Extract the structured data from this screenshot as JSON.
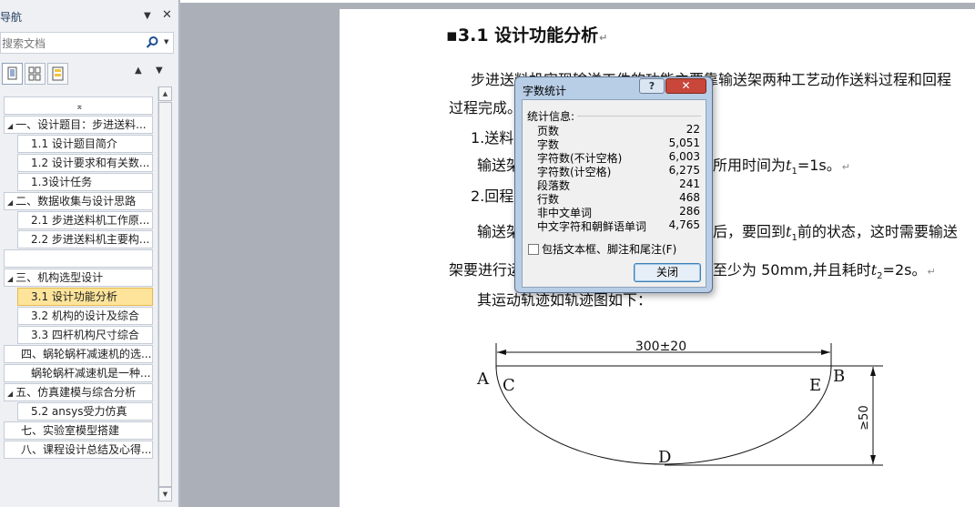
{
  "nav": {
    "title": "导航",
    "dropdown_icon": "triangle-down-icon",
    "close_glyph": "✕",
    "search_placeholder": "搜索文档",
    "search_icon": "search-icon",
    "view_buttons": [
      "headings-view-icon",
      "pages-view-icon",
      "results-view-icon"
    ],
    "prev_glyph": "▲",
    "next_glyph": "▼",
    "collapse_glyph": "⌅",
    "items": [
      {
        "label": "",
        "level": 1,
        "type": "collapse"
      },
      {
        "label": "一、设计题目：步进送料...",
        "level": 1,
        "expanded": true
      },
      {
        "label": "1.1 设计题目简介",
        "level": 2
      },
      {
        "label": "1.2 设计要求和有关数...",
        "level": 2
      },
      {
        "label": "1.3设计任务",
        "level": 2
      },
      {
        "label": "二、数据收集与设计思路",
        "level": 1,
        "expanded": true
      },
      {
        "label": "2.1 步进送料机工作原...",
        "level": 2
      },
      {
        "label": "2.2 步进送料机主要构...",
        "level": 2
      },
      {
        "label": "",
        "level": 1
      },
      {
        "label": "三、机构选型设计",
        "level": 1,
        "expanded": true
      },
      {
        "label": "3.1 设计功能分析",
        "level": 2,
        "selected": true
      },
      {
        "label": "3.2 机构的设计及综合",
        "level": 2
      },
      {
        "label": "3.3 四杆机构尺寸综合",
        "level": 2
      },
      {
        "label": "四、蜗轮蜗杆减速机的选...",
        "level": 1
      },
      {
        "label": "蜗轮蜗杆减速机是一种...",
        "level": 2
      },
      {
        "label": "五、仿真建模与综合分析",
        "level": 1,
        "expanded": true
      },
      {
        "label": "5.2 ansys受力仿真",
        "level": 2
      },
      {
        "label": "七、实验室模型搭建",
        "level": 1
      },
      {
        "label": "八、课程设计总结及心得...",
        "level": 1
      }
    ]
  },
  "document": {
    "heading": "3.1  设计功能分析",
    "para1_a": "步进送料机实现输送工件的功能主要靠输送架两种工艺动作送料过程和回程",
    "para1_b": "过程完成。",
    "item1": "1.送料过",
    "item1_body_a": "输送架",
    "item1_body_b": "所用时间为",
    "item1_var": "t",
    "item1_sub": "1",
    "item1_tail": "=1s。",
    "item2": "2.回程过",
    "item2_body_a": "输送架",
    "item2_body_b": "后，要回到",
    "item2_var": "t",
    "item2_sub": "1",
    "item2_tail": "前的状态，这时需要输送",
    "item2_line2_a": "架要进行运",
    "item2_line2_b": "至少为 50mm,并且耗时",
    "item2_var2": "t",
    "item2_sub2": "2",
    "item2_tail2": "=2s。",
    "para3": "其运动轨迹如轨迹图如下：",
    "pm": "↵"
  },
  "figure": {
    "width_label": "300±20",
    "height_label": "≥50",
    "point_a": "A",
    "point_b": "B",
    "point_c": "C",
    "point_d": "D",
    "point_e": "E"
  },
  "dialog": {
    "title": "字数统计",
    "help": "?",
    "close": "✕",
    "section": "统计信息:",
    "stats": [
      {
        "label": "页数",
        "value": "22"
      },
      {
        "label": "字数",
        "value": "5,051"
      },
      {
        "label": "字符数(不计空格)",
        "value": "6,003"
      },
      {
        "label": "字符数(计空格)",
        "value": "6,275"
      },
      {
        "label": "段落数",
        "value": "241"
      },
      {
        "label": "行数",
        "value": "468"
      },
      {
        "label": "非中文单词",
        "value": "286"
      },
      {
        "label": "中文字符和朝鲜语单词",
        "value": "4,765"
      }
    ],
    "include_label": "包括文本框、脚注和尾注(F)",
    "include_checked": false,
    "close_button": "关闭"
  }
}
